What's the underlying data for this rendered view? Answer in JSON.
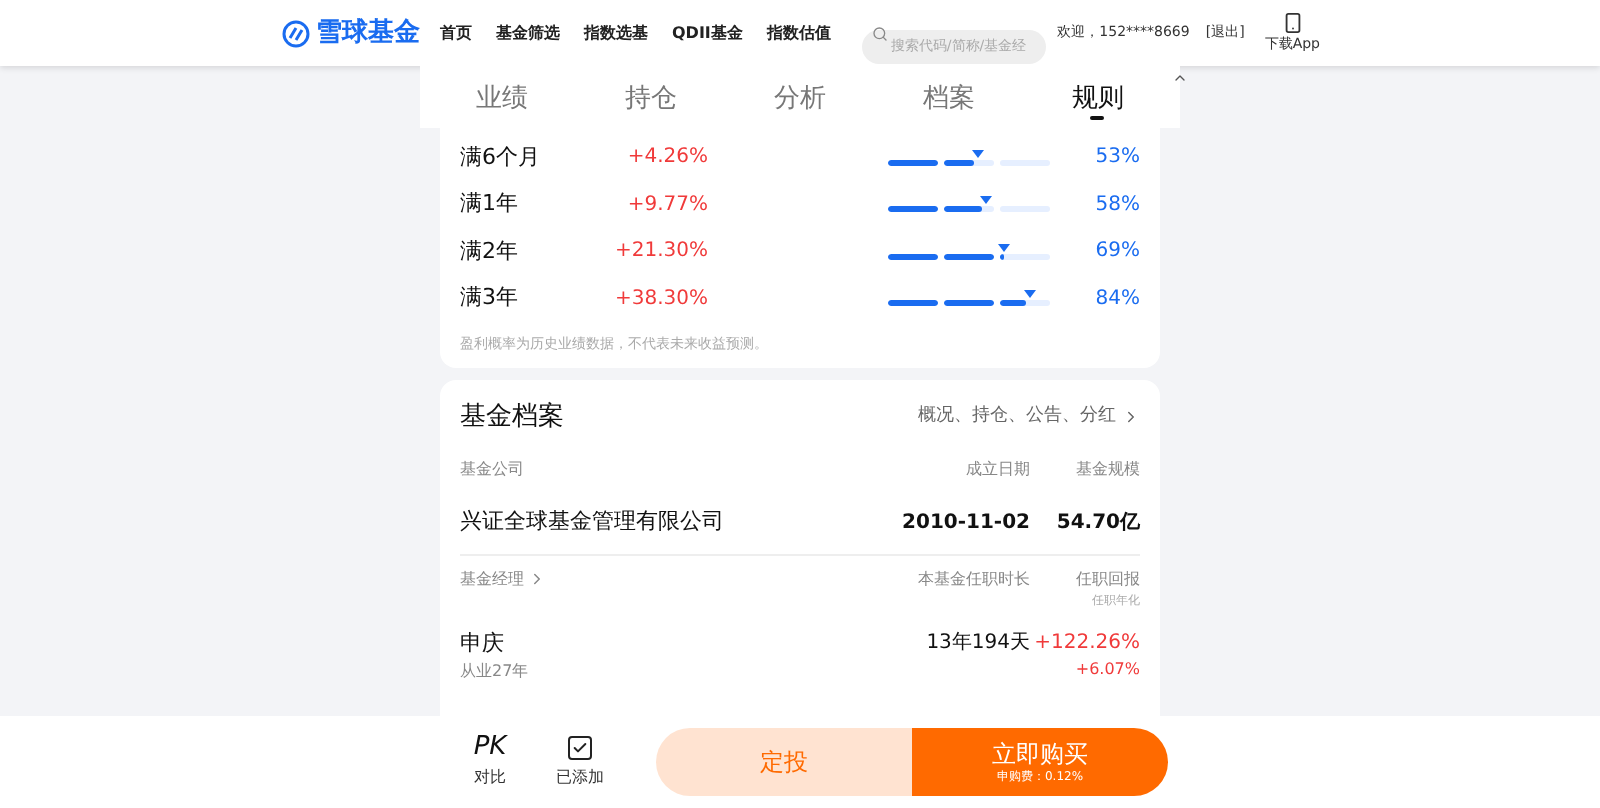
{
  "header": {
    "logo": "雪球基金",
    "nav": [
      "首页",
      "基金筛选",
      "指数选基",
      "QDII基金",
      "指数估值"
    ],
    "search": {
      "placeholder": "搜索代码/简称/基金经"
    },
    "greeting": "欢迎，152****8669",
    "logout": "[退出]",
    "download": "下载App"
  },
  "tabs": [
    {
      "label": "业绩",
      "selected": false
    },
    {
      "label": "持仓",
      "selected": false
    },
    {
      "label": "分析",
      "selected": false
    },
    {
      "label": "档案",
      "selected": false
    },
    {
      "label": "规则",
      "selected": true
    }
  ],
  "probability": {
    "rows": [
      {
        "period": "满6个月",
        "return": "+4.26%",
        "level": 0.53,
        "reading": "53%"
      },
      {
        "period": "满1年",
        "return": "+9.77%",
        "level": 0.58,
        "reading": "58%"
      },
      {
        "period": "满2年",
        "return": "+21.30%",
        "level": 0.69,
        "reading": "69%"
      },
      {
        "period": "满3年",
        "return": "+38.30%",
        "level": 0.84,
        "reading": "84%"
      }
    ],
    "note": "盈利概率为历史业绩数据，不代表未来收益预测。"
  },
  "profile": {
    "title": "基金档案",
    "link": "概况、持仓、公告、分红",
    "company_header": [
      "基金公司",
      "成立日期",
      "基金规模"
    ],
    "company": {
      "name": "兴证全球基金管理有限公司",
      "founded": "2010-11-02",
      "size": "54.70亿"
    },
    "manager_header": {
      "label": "基金经理",
      "tenure": "本基金任职时长",
      "return": "任职回报",
      "return_sub": "任职年化"
    },
    "manager": {
      "name": "申庆",
      "experience": "从业27年",
      "tenure": "13年194天",
      "return": "+122.26%",
      "annualized": "+6.07%"
    }
  },
  "bottom_bar": {
    "pk": "PK",
    "pk_label": "对比",
    "added": {
      "label": "已添加",
      "checked": true
    },
    "plan": "定投",
    "buy": "立即购买",
    "fee": "申购费：0.12%"
  }
}
